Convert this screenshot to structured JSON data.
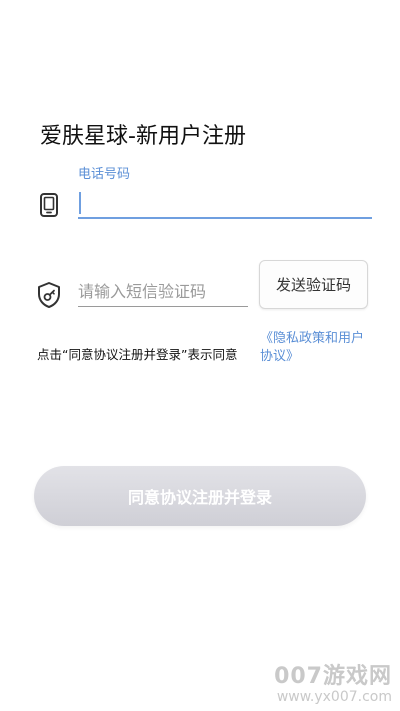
{
  "page": {
    "title": "爱肤星球-新用户注册"
  },
  "phone": {
    "label": "电话号码",
    "value": "",
    "icon": "phone-icon"
  },
  "code": {
    "placeholder": "请输入短信验证码",
    "value": "",
    "icon": "shield-key-icon",
    "send_button_label": "发送验证码"
  },
  "agreement": {
    "prefix": "点击“同意协议注册并登录”表示同意",
    "link_text": "《隐私政策和用户协议》"
  },
  "register_button": {
    "label": "同意协议注册并登录"
  },
  "watermark": {
    "main": "007游戏网",
    "url": "www.yx007.com"
  },
  "colors": {
    "accent": "#5b8fd6",
    "button_disabled": "#d8d8de"
  }
}
